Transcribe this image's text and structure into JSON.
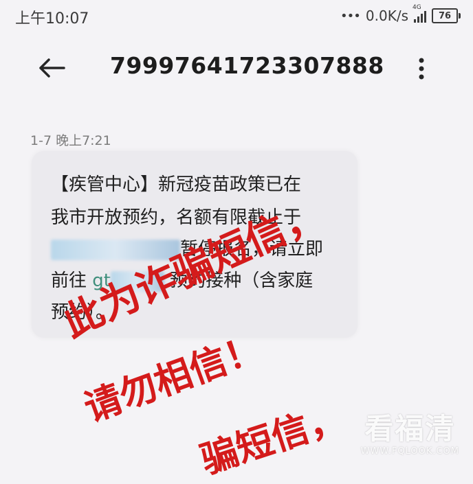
{
  "status_bar": {
    "time": "上午10:07",
    "dots": "•••",
    "net_speed": "0.0K/s",
    "network": "4G",
    "battery": "76"
  },
  "header": {
    "title": "79997641723307888",
    "back_icon": "arrow-left-icon",
    "more_icon": "more-vertical-icon"
  },
  "message": {
    "timestamp": "1-7 晚上7:21",
    "lines": {
      "l1": "【疾管中心】新冠疫苗政策已在",
      "l2": "我市开放预约，名额有限截止于",
      "l3_suffix": "暂停报名，请立即",
      "l4_prefix": "前往",
      "l4_link": "gt",
      "l4_suffix": "预约接种（含家庭",
      "l5": "预约）。"
    }
  },
  "overlay": {
    "line1": "此为诈骗短信，",
    "line2": "请勿相信！",
    "line3": "骗短信，"
  },
  "watermark": {
    "brand": "看福清",
    "url": "WWW.FQLOOK.COM"
  },
  "colors": {
    "background": "#f4f3f6",
    "bubble": "#ebeaee",
    "link": "#3f8f7c",
    "overlay_red": "#d41b1b"
  }
}
